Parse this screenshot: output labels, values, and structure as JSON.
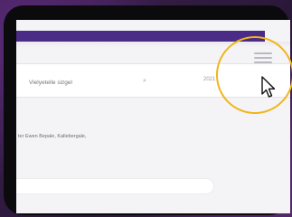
{
  "search": {
    "placeholder": "Vielyetelle sizgel"
  },
  "filter": {
    "date_label": "2021"
  },
  "content": {
    "text": "ter Ewen Bepale, Kallebergale,"
  },
  "icons": {
    "menu": "hamburger-icon",
    "search": "search-icon",
    "pointer": "cursor-icon"
  },
  "colors": {
    "appbar": "#4a2b86",
    "highlight": "#f0b51b",
    "device": "#0b0b0e"
  }
}
